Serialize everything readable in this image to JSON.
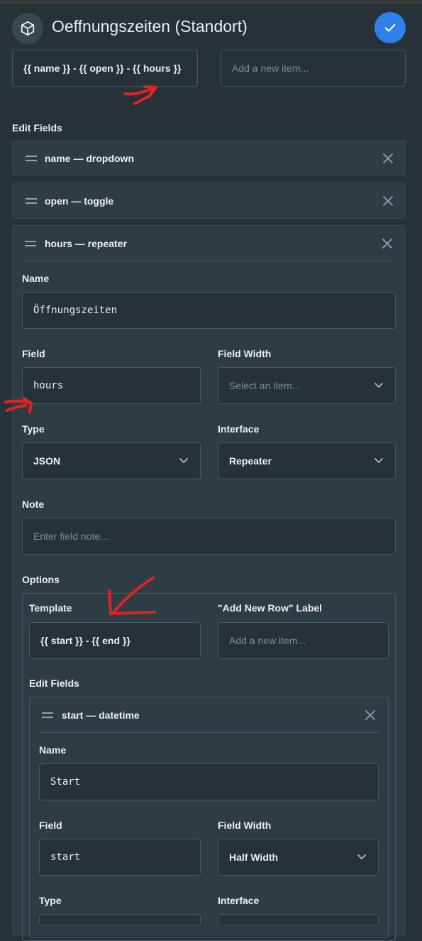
{
  "header": {
    "title": "Oeffnungszeiten (Standort)",
    "icon": "cube-icon",
    "save_icon": "check-icon"
  },
  "top_fields": {
    "template_value": "{{ name }} - {{ open }} - {{ hours }}",
    "add_row_placeholder": "Add a new item..."
  },
  "edit_fields": {
    "title": "Edit Fields",
    "rows": [
      {
        "label": "name — dropdown"
      },
      {
        "label": "open — toggle"
      },
      {
        "label": "hours — repeater"
      }
    ]
  },
  "hours_panel": {
    "name_label": "Name",
    "name_value": "Öffnungszeiten",
    "field_label": "Field",
    "field_value": "hours",
    "field_width_label": "Field Width",
    "field_width_placeholder": "Select an item...",
    "type_label": "Type",
    "type_value": "JSON",
    "interface_label": "Interface",
    "interface_value": "Repeater",
    "note_label": "Note",
    "note_placeholder": "Enter field note...",
    "options_label": "Options",
    "options": {
      "template_label": "Template",
      "template_value": "{{ start }} - {{ end }}",
      "add_new_row_label": "\"Add New Row\" Label",
      "add_new_row_placeholder": "Add a new item...",
      "edit_fields_label": "Edit Fields",
      "start_field": {
        "row_label": "start — datetime",
        "name_label": "Name",
        "name_value": "Start",
        "field_label": "Field",
        "field_value": "start",
        "field_width_label": "Field Width",
        "field_width_value": "Half Width",
        "type_label": "Type",
        "interface_label": "Interface"
      }
    }
  },
  "colors": {
    "background": "#263238",
    "accent": "#2f80ed",
    "annotation": "#e02424"
  }
}
